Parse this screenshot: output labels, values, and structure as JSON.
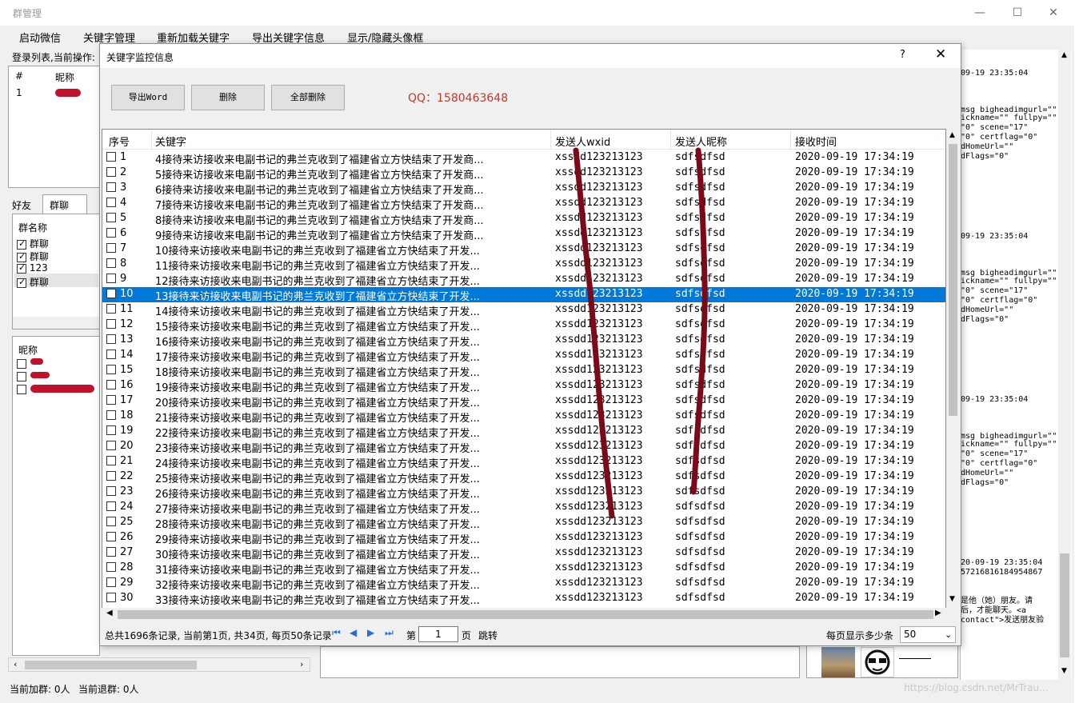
{
  "main": {
    "title": "群管理",
    "menu": [
      "启动微信",
      "关键字管理",
      "重新加载关键字",
      "导出关键字信息",
      "显示/隐藏头像框"
    ],
    "login_list_label": "登录列表,当前操作:",
    "login_table_headers": [
      "#",
      "昵称"
    ],
    "login_row_index": "1",
    "tabs": [
      "好友",
      "群聊"
    ],
    "group_header": "群名称",
    "groups": [
      {
        "name": "群聊",
        "checked": true
      },
      {
        "name": "群聊",
        "checked": true
      },
      {
        "name": "123",
        "checked": true
      },
      {
        "name": "群聊",
        "checked": true
      }
    ],
    "member_header": "昵称",
    "status_join": "当前加群: 0人",
    "status_leave": "当前退群: 0人"
  },
  "log": {
    "lines": [
      "09-19 23:35:04",
      "msg bigheadimgurl=\"\"",
      "ickname=\"\" fullpy=\"\"",
      "\"0\" scene=\"17\"",
      "\"0\" certflag=\"0\"",
      "dHomeUrl=\"\"",
      "dFlags=\"0\"",
      "09-19 23:35:04",
      "msg bigheadimgurl=\"\"",
      "ickname=\"\" fullpy=\"\"",
      "\"0\" scene=\"17\"",
      "\"0\" certflag=\"0\"",
      "dHomeUrl=\"\"",
      "dFlags=\"0\"",
      "09-19 23:35:04",
      "msg bigheadimgurl=\"\"",
      "ickname=\"\" fullpy=\"\"",
      "\"0\" scene=\"17\"",
      "\"0\" certflag=\"0\"",
      "dHomeUrl=\"\"",
      "dFlags=\"0\"",
      "20-09-19 23:35:04",
      "57216816184954867",
      "是他（她）朋友。请",
      "后，才能聊天。<a",
      "contact\">发送朋友验"
    ],
    "watermark": "https://blog.csdn.net/MrTrau..."
  },
  "dialog": {
    "title": "关键字监控信息",
    "help": "?",
    "close": "✕",
    "buttons": {
      "export": "导出Word",
      "delete": "删除",
      "delete_all": "全部删除"
    },
    "qq": "QQ：1580463648",
    "columns": [
      "序号",
      "关键字",
      "发送人wxid",
      "发送人昵称",
      "接收时间"
    ],
    "wxid": "xssdd123213123",
    "nickname": "sdfsdfsd",
    "time": "2020-09-19 17:34:19",
    "selected_index": 10,
    "keywords": [
      "4接待来访接收来电副书记的弗兰克收到了福建省立方快结束了开发商...",
      "5接待来访接收来电副书记的弗兰克收到了福建省立方快结束了开发商...",
      "6接待来访接收来电副书记的弗兰克收到了福建省立方快结束了开发商...",
      "7接待来访接收来电副书记的弗兰克收到了福建省立方快结束了开发商...",
      "8接待来访接收来电副书记的弗兰克收到了福建省立方快结束了开发商...",
      "9接待来访接收来电副书记的弗兰克收到了福建省立方快结束了开发商...",
      "10接待来访接收来电副书记的弗兰克收到了福建省立方快结束了开发...",
      "11接待来访接收来电副书记的弗兰克收到了福建省立方快结束了开发...",
      "12接待来访接收来电副书记的弗兰克收到了福建省立方快结束了开发...",
      "13接待来访接收来电副书记的弗兰克收到了福建省立方快结束了开发...",
      "14接待来访接收来电副书记的弗兰克收到了福建省立方快结束了开发...",
      "15接待来访接收来电副书记的弗兰克收到了福建省立方快结束了开发...",
      "16接待来访接收来电副书记的弗兰克收到了福建省立方快结束了开发...",
      "17接待来访接收来电副书记的弗兰克收到了福建省立方快结束了开发...",
      "18接待来访接收来电副书记的弗兰克收到了福建省立方快结束了开发...",
      "19接待来访接收来电副书记的弗兰克收到了福建省立方快结束了开发...",
      "20接待来访接收来电副书记的弗兰克收到了福建省立方快结束了开发...",
      "21接待来访接收来电副书记的弗兰克收到了福建省立方快结束了开发...",
      "22接待来访接收来电副书记的弗兰克收到了福建省立方快结束了开发...",
      "23接待来访接收来电副书记的弗兰克收到了福建省立方快结束了开发...",
      "24接待来访接收来电副书记的弗兰克收到了福建省立方快结束了开发...",
      "25接待来访接收来电副书记的弗兰克收到了福建省立方快结束了开发...",
      "26接待来访接收来电副书记的弗兰克收到了福建省立方快结束了开发...",
      "27接待来访接收来电副书记的弗兰克收到了福建省立方快结束了开发...",
      "28接待来访接收来电副书记的弗兰克收到了福建省立方快结束了开发...",
      "29接待来访接收来电副书记的弗兰克收到了福建省立方快结束了开发...",
      "30接待来访接收来电副书记的弗兰克收到了福建省立方快结束了开发...",
      "31接待来访接收来电副书记的弗兰克收到了福建省立方快结束了开发...",
      "32接待来访接收来电副书记的弗兰克收到了福建省立方快结束了开发...",
      "33接待来访接收来电副书记的弗兰克收到了福建省立方快结束了开发..."
    ],
    "pager": {
      "summary": "总共1696条记录, 当前第1页, 共34页, 每页50条记录",
      "page_prefix": "第",
      "page_value": "1",
      "page_suffix": "页",
      "jump": "跳转",
      "page_size_label": "每页显示多少条",
      "page_size_value": "50"
    }
  },
  "colors": {
    "selected": "#0078d7",
    "qq": "#c0392b",
    "scribble": "#7a0a1a"
  }
}
